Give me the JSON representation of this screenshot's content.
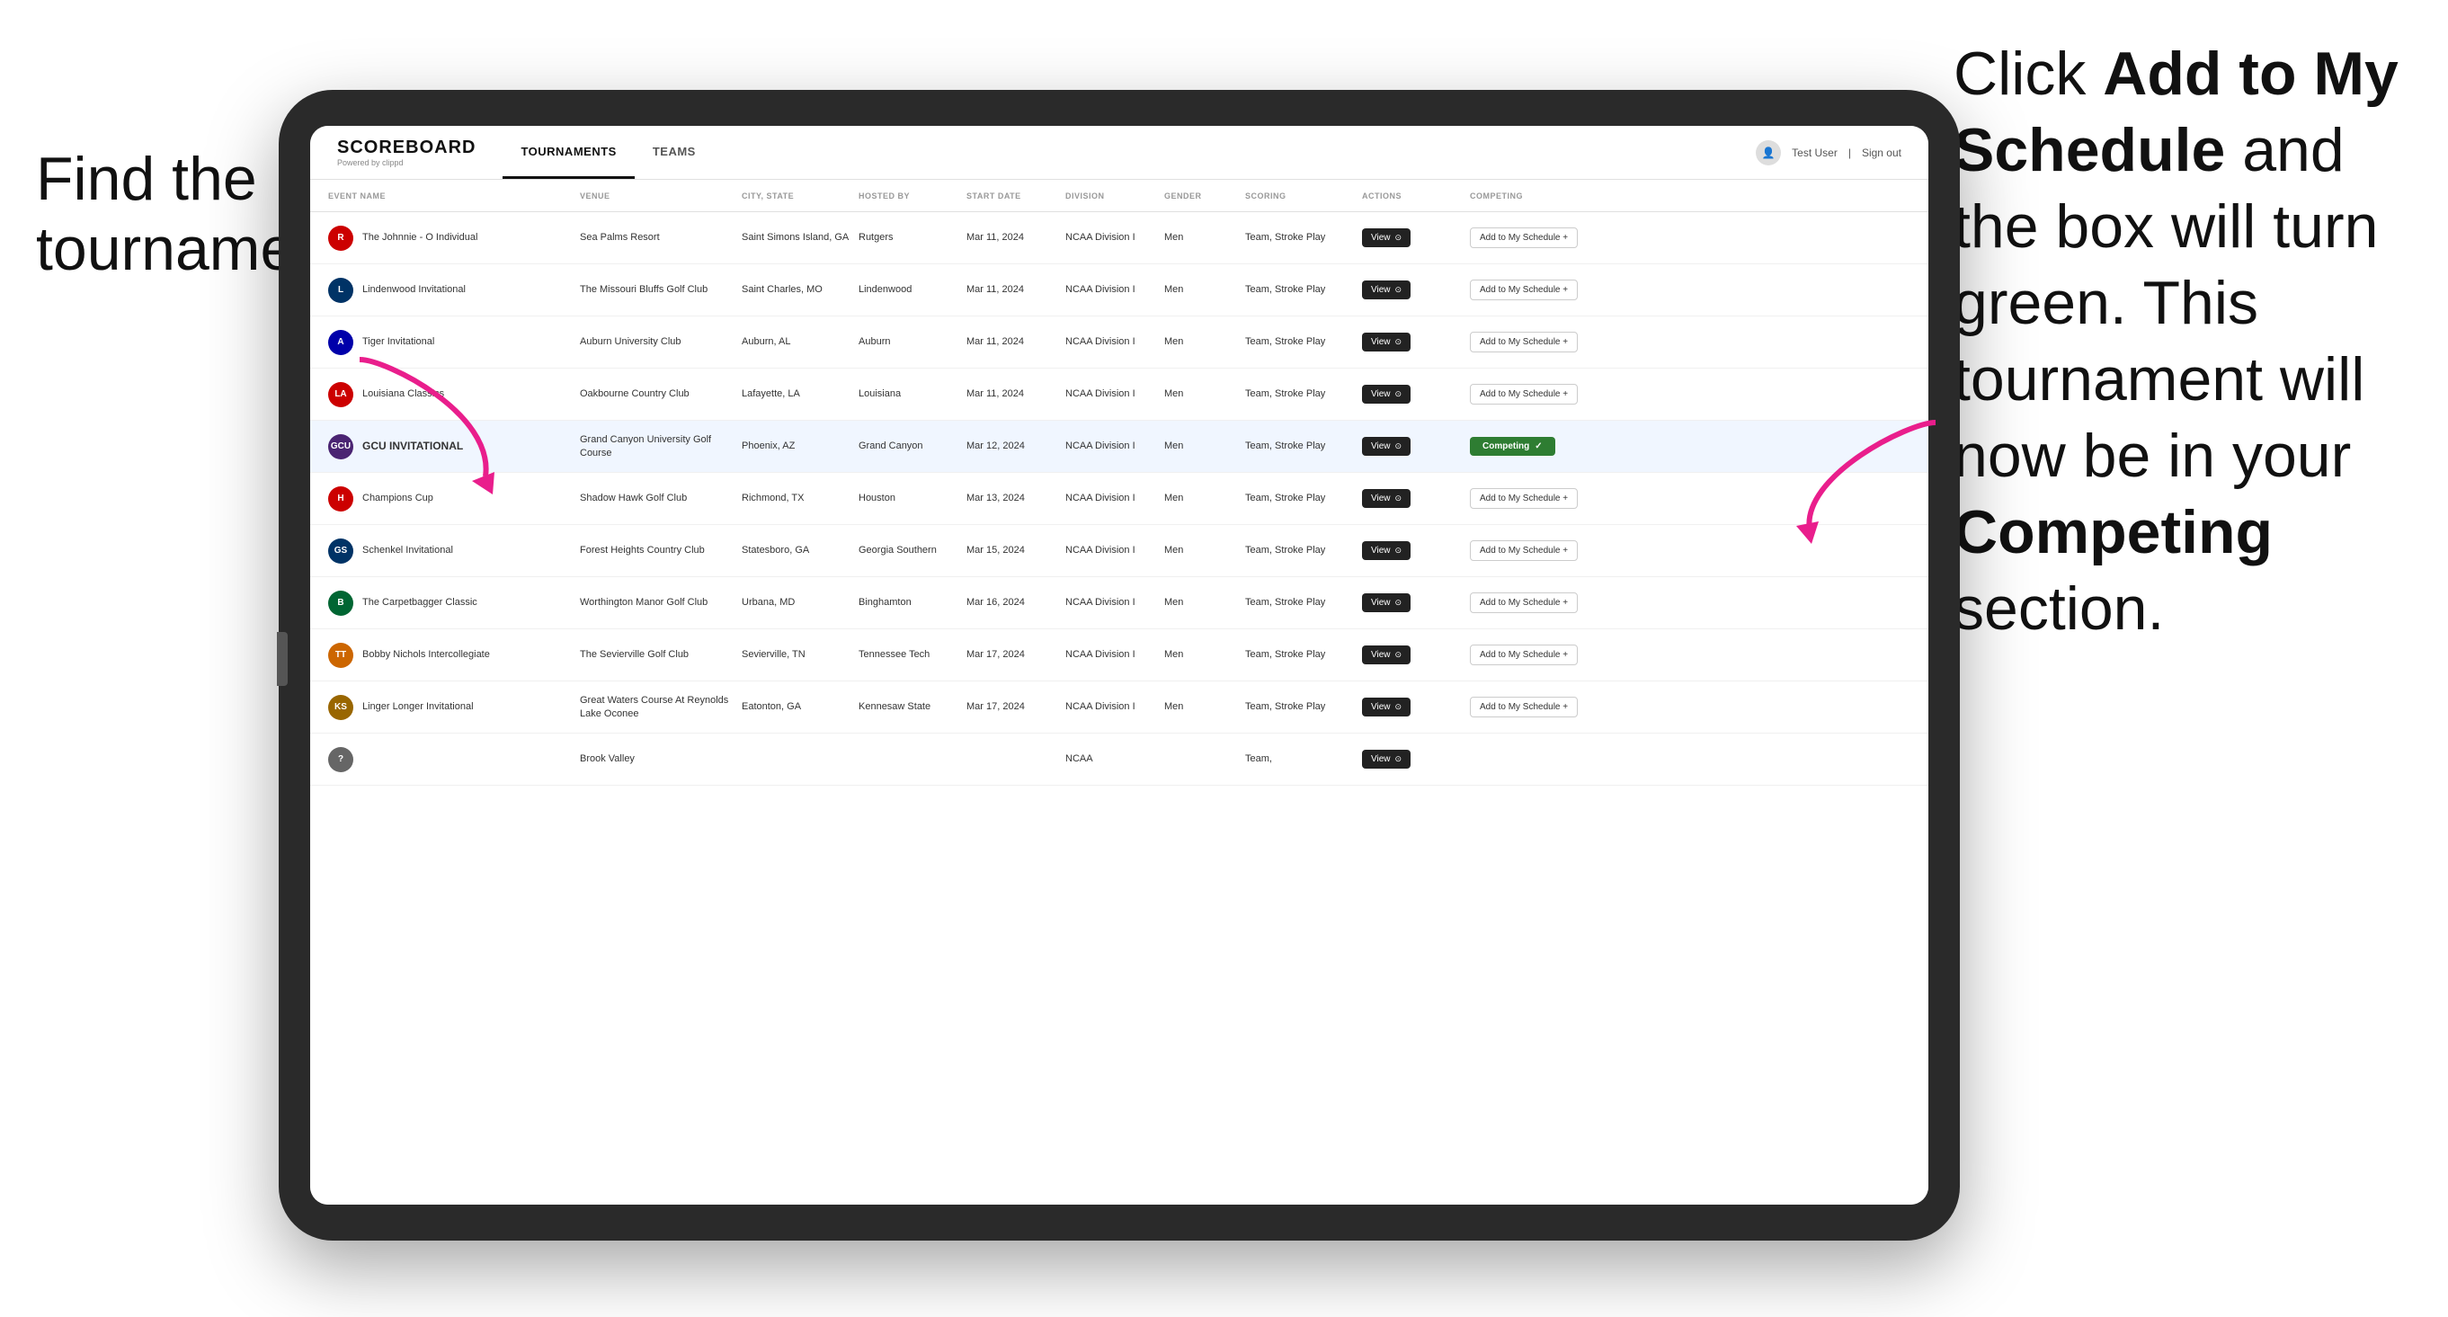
{
  "annotations": {
    "left": "Find the\ntournament.",
    "right_pre": "Click ",
    "right_bold1": "Add to My\nSchedule",
    "right_mid": " and the\nbox will turn green.\nThis tournament\nwill now be in\nyour ",
    "right_bold2": "Competing",
    "right_post": "\nsection."
  },
  "app": {
    "logo": "SCOREBOARD",
    "powered_by": "Powered by clippd",
    "nav_tabs": [
      "TOURNAMENTS",
      "TEAMS"
    ],
    "active_tab": "TOURNAMENTS",
    "user": "Test User",
    "sign_out": "Sign out"
  },
  "table": {
    "headers": [
      "EVENT NAME",
      "VENUE",
      "CITY, STATE",
      "HOSTED BY",
      "START DATE",
      "DIVISION",
      "GENDER",
      "SCORING",
      "ACTIONS",
      "COMPETING"
    ],
    "rows": [
      {
        "logo_letter": "R",
        "logo_color": "#cc0000",
        "event": "The Johnnie - O Individual",
        "venue": "Sea Palms Resort",
        "city_state": "Saint Simons Island, GA",
        "hosted_by": "Rutgers",
        "start_date": "Mar 11, 2024",
        "division": "NCAA Division I",
        "gender": "Men",
        "scoring": "Team, Stroke Play",
        "action": "View",
        "competing": "Add to My Schedule +",
        "is_competing": false,
        "highlighted": false
      },
      {
        "logo_letter": "L",
        "logo_color": "#003366",
        "event": "Lindenwood Invitational",
        "venue": "The Missouri Bluffs Golf Club",
        "city_state": "Saint Charles, MO",
        "hosted_by": "Lindenwood",
        "start_date": "Mar 11, 2024",
        "division": "NCAA Division I",
        "gender": "Men",
        "scoring": "Team, Stroke Play",
        "action": "View",
        "competing": "Add to My Schedule +",
        "is_competing": false,
        "highlighted": false
      },
      {
        "logo_letter": "A",
        "logo_color": "#0000aa",
        "event": "Tiger Invitational",
        "venue": "Auburn University Club",
        "city_state": "Auburn, AL",
        "hosted_by": "Auburn",
        "start_date": "Mar 11, 2024",
        "division": "NCAA Division I",
        "gender": "Men",
        "scoring": "Team, Stroke Play",
        "action": "View",
        "competing": "Add to My Schedule +",
        "is_competing": false,
        "highlighted": false
      },
      {
        "logo_letter": "LA",
        "logo_color": "#cc0000",
        "event": "Louisiana Classics",
        "venue": "Oakbourne Country Club",
        "city_state": "Lafayette, LA",
        "hosted_by": "Louisiana",
        "start_date": "Mar 11, 2024",
        "division": "NCAA Division I",
        "gender": "Men",
        "scoring": "Team, Stroke Play",
        "action": "View",
        "competing": "Add to My Schedule +",
        "is_competing": false,
        "highlighted": false
      },
      {
        "logo_letter": "GCU",
        "logo_color": "#4a2472",
        "event": "GCU INVITATIONAL",
        "venue": "Grand Canyon University Golf Course",
        "city_state": "Phoenix, AZ",
        "hosted_by": "Grand Canyon",
        "start_date": "Mar 12, 2024",
        "division": "NCAA Division I",
        "gender": "Men",
        "scoring": "Team, Stroke Play",
        "action": "View",
        "competing": "Competing ✓",
        "is_competing": true,
        "highlighted": true
      },
      {
        "logo_letter": "H",
        "logo_color": "#cc0000",
        "event": "Champions Cup",
        "venue": "Shadow Hawk Golf Club",
        "city_state": "Richmond, TX",
        "hosted_by": "Houston",
        "start_date": "Mar 13, 2024",
        "division": "NCAA Division I",
        "gender": "Men",
        "scoring": "Team, Stroke Play",
        "action": "View",
        "competing": "Add to My Schedule +",
        "is_competing": false,
        "highlighted": false
      },
      {
        "logo_letter": "GS",
        "logo_color": "#003366",
        "event": "Schenkel Invitational",
        "venue": "Forest Heights Country Club",
        "city_state": "Statesboro, GA",
        "hosted_by": "Georgia Southern",
        "start_date": "Mar 15, 2024",
        "division": "NCAA Division I",
        "gender": "Men",
        "scoring": "Team, Stroke Play",
        "action": "View",
        "competing": "Add to My Schedule +",
        "is_competing": false,
        "highlighted": false
      },
      {
        "logo_letter": "B",
        "logo_color": "#006633",
        "event": "The Carpetbagger Classic",
        "venue": "Worthington Manor Golf Club",
        "city_state": "Urbana, MD",
        "hosted_by": "Binghamton",
        "start_date": "Mar 16, 2024",
        "division": "NCAA Division I",
        "gender": "Men",
        "scoring": "Team, Stroke Play",
        "action": "View",
        "competing": "Add to My Schedule +",
        "is_competing": false,
        "highlighted": false
      },
      {
        "logo_letter": "TT",
        "logo_color": "#cc6600",
        "event": "Bobby Nichols Intercollegiate",
        "venue": "The Sevierville Golf Club",
        "city_state": "Sevierville, TN",
        "hosted_by": "Tennessee Tech",
        "start_date": "Mar 17, 2024",
        "division": "NCAA Division I",
        "gender": "Men",
        "scoring": "Team, Stroke Play",
        "action": "View",
        "competing": "Add to My Schedule +",
        "is_competing": false,
        "highlighted": false
      },
      {
        "logo_letter": "KS",
        "logo_color": "#996600",
        "event": "Linger Longer Invitational",
        "venue": "Great Waters Course At Reynolds Lake Oconee",
        "city_state": "Eatonton, GA",
        "hosted_by": "Kennesaw State",
        "start_date": "Mar 17, 2024",
        "division": "NCAA Division I",
        "gender": "Men",
        "scoring": "Team, Stroke Play",
        "action": "View",
        "competing": "Add to My Schedule +",
        "is_competing": false,
        "highlighted": false
      },
      {
        "logo_letter": "?",
        "logo_color": "#666",
        "event": "",
        "venue": "Brook Valley",
        "city_state": "",
        "hosted_by": "",
        "start_date": "",
        "division": "NCAA",
        "gender": "",
        "scoring": "Team,",
        "action": "View",
        "competing": "",
        "is_competing": false,
        "highlighted": false
      }
    ]
  }
}
